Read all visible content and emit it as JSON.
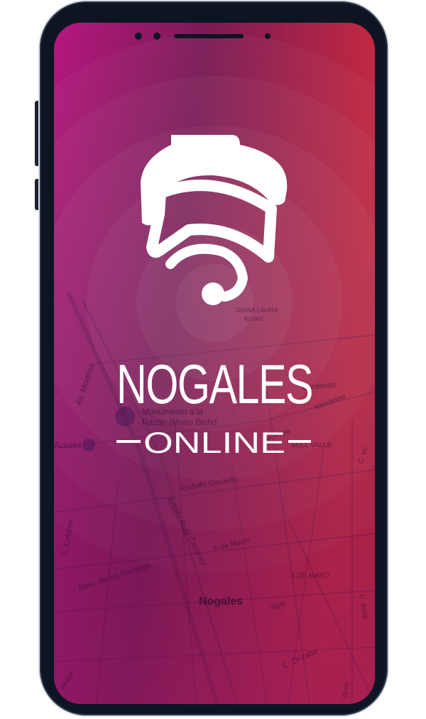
{
  "app": {
    "brand": "NOGALES",
    "subtitle": "ONLINE",
    "logo_icon": "wifi-location-pin-icon"
  },
  "map": {
    "labels": {
      "av_morelos": "Av. Morelos",
      "monumento_line1": "Monumento a la",
      "monumento_line2": "Razón (Mono Bichi)",
      "access": "Access",
      "rodolfo": "Rodolfo Garavito",
      "adolfo": "Adolfo Ruiz Cortinez",
      "cinco_mayo": "5 de Mayo",
      "cinco_mayo_caps": "5 DE MAYO",
      "colosio": "C. Colome",
      "doctores": "Beliz. de los Doctores",
      "nogales": "Nogales",
      "tepic": "Tepic",
      "orizaba": "C. Orizaba",
      "buila": "C. Buila",
      "cardenas": "Cardenas",
      "mendelino": "Mendelino",
      "prefectura": "Av. Prefe",
      "bellvalle": "BELL VALLE",
      "vicori": "Vicori",
      "arizpe": "Arizpe",
      "diana": "DIANA LAURA",
      "rojas": "ROJAS",
      "sc": "C. Ve"
    }
  },
  "colors": {
    "gradient_left": "#b5187f",
    "gradient_mid": "#7d1a55",
    "gradient_right": "#c8283e",
    "logo": "#ffffff",
    "phone_frame": "#0d1522"
  }
}
